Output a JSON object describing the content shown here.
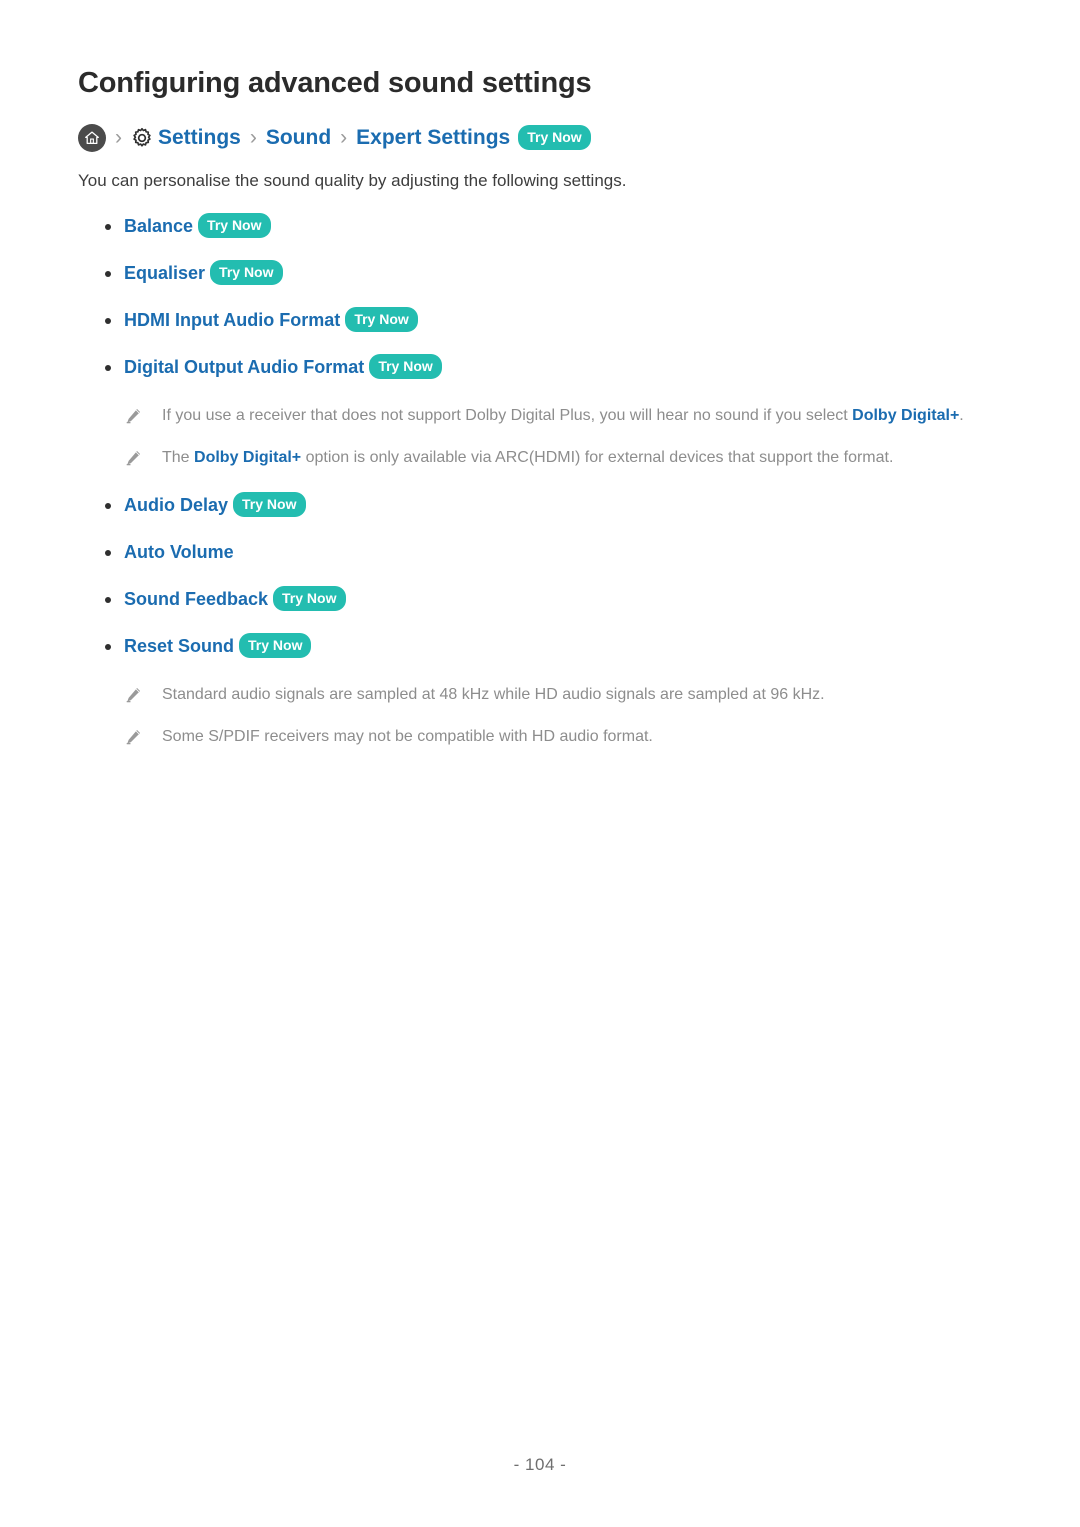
{
  "document": {
    "title": "Configuring advanced sound settings",
    "intro": "You can personalise the sound quality by adjusting the following settings.",
    "page_number": "- 104 -"
  },
  "breadcrumb": {
    "home_icon": "home-icon",
    "separator": "›",
    "gear_icon": "gear-icon",
    "items": [
      {
        "label": "Settings"
      },
      {
        "label": "Sound"
      },
      {
        "label": "Expert Settings"
      }
    ],
    "try_now": "Try Now"
  },
  "labels": {
    "try_now": "Try Now"
  },
  "settings_group_1": [
    {
      "label": "Balance",
      "try_now": "Try Now"
    },
    {
      "label": "Equaliser",
      "try_now": "Try Now"
    },
    {
      "label": "HDMI Input Audio Format",
      "try_now": "Try Now"
    },
    {
      "label": "Digital Output Audio Format",
      "try_now": "Try Now"
    }
  ],
  "notes_group_1": [
    {
      "icon": "pencil-icon",
      "pre": "If you use a receiver that does not support Dolby Digital Plus, you will hear no sound if you select ",
      "strong": "Dolby Digital+",
      "post": "."
    },
    {
      "icon": "pencil-icon",
      "pre": "The ",
      "strong": "Dolby Digital+",
      "post": " option is only available via ARC(HDMI) for external devices that support the format."
    }
  ],
  "settings_group_2": [
    {
      "label": "Audio Delay",
      "try_now": "Try Now"
    },
    {
      "label": "Auto Volume",
      "try_now": ""
    },
    {
      "label": "Sound Feedback",
      "try_now": "Try Now"
    },
    {
      "label": "Reset Sound",
      "try_now": "Try Now"
    }
  ],
  "notes_group_2": [
    {
      "icon": "pencil-icon",
      "pre": "Standard audio signals are sampled at 48 kHz while HD audio signals are sampled at 96 kHz.",
      "strong": "",
      "post": ""
    },
    {
      "icon": "pencil-icon",
      "pre": "Some S/PDIF receivers may not be compatible with HD audio format.",
      "strong": "",
      "post": ""
    }
  ],
  "colors": {
    "link": "#1b6cb0",
    "badge": "#23bdb0",
    "note_text": "#8d8d8d",
    "title": "#2b2b2b"
  }
}
